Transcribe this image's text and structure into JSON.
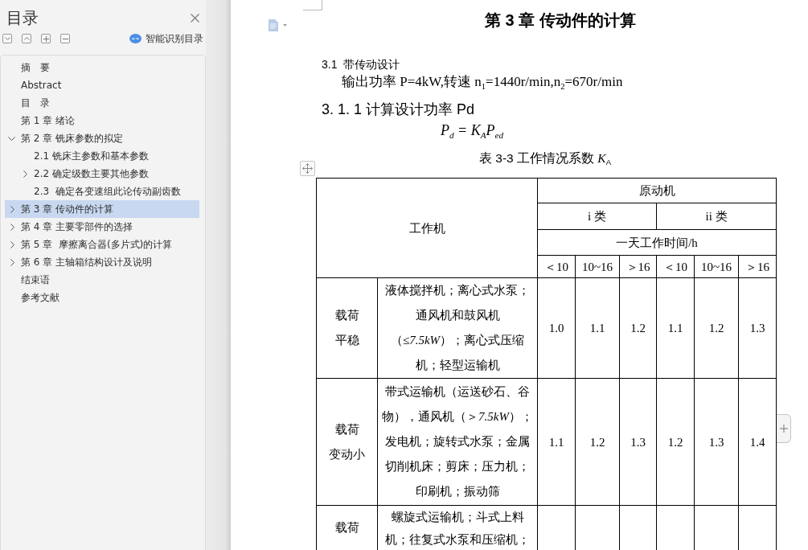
{
  "sidebar": {
    "title": "目录",
    "smart_toc": "智能识别目录",
    "items": [
      {
        "label": "摘　要",
        "selected": false
      },
      {
        "label": "Abstract",
        "selected": false
      },
      {
        "label": "目　录",
        "selected": false
      },
      {
        "label": "第 1 章 绪论",
        "selected": false
      },
      {
        "label": "第 2 章 铣床参数的拟定",
        "selected": false,
        "expanded": true,
        "children": [
          {
            "label": "2.1 铣床主参数和基本参数",
            "selected": false
          },
          {
            "label": "2.2 确定级数主要其他参数",
            "selected": false,
            "expanded": false
          },
          {
            "label": "2.3  确定各变速组此论传动副齿数",
            "selected": false
          }
        ]
      },
      {
        "label": "第 3 章 传动件的计算",
        "selected": true,
        "expanded": false
      },
      {
        "label": "第 4 章 主要零部件的选择",
        "selected": false,
        "expanded": false
      },
      {
        "label": "第 5 章  摩擦离合器(多片式)的计算",
        "selected": false,
        "expanded": false
      },
      {
        "label": "第 6 章 主轴箱结构设计及说明",
        "selected": false,
        "expanded": false
      },
      {
        "label": "结束语",
        "selected": false
      },
      {
        "label": "参考文献",
        "selected": false
      }
    ]
  },
  "document": {
    "chapter_title": "第 3 章 传动件的计算",
    "section_heading": "3.1  带传动设计",
    "given": "输出功率 P=4kW,转速 n$_{1}$=1440r/min,n$_{2}$=670r/min",
    "subsection_heading": "3. 1. 1 计算设计功率 Pd",
    "formula": "P$_{d}$ = K$_{A}$P$_{ed}$",
    "table_caption": "表 3-3 工作情况系数 *K*$_{A}$",
    "table": {
      "work_machine": "工作机",
      "prime_mover": "原动机",
      "classes": [
        "i 类",
        "ii 类"
      ],
      "hours_label": "一天工作时间/h",
      "hour_ranges": [
        "＜10",
        "10~16",
        "＞16",
        "＜10",
        "10~16",
        "＞16"
      ],
      "rows": [
        {
          "load": [
            "载荷",
            "平稳"
          ],
          "description": [
            "液体搅拌机；离心式水泵；",
            "通风机和鼓风机",
            "（≤*7.5kW*）；离心式压缩",
            "机；轻型运输机"
          ],
          "values": [
            "1.0",
            "1.1",
            "1.2",
            "1.1",
            "1.2",
            "1.3"
          ]
        },
        {
          "load": [
            "载荷",
            "变动小"
          ],
          "description": [
            "带式运输机（运送砂石、谷",
            "物），通风机（＞*7.5kW*）；",
            "发电机；旋转式水泵；金属",
            "切削机床；剪床；压力机；",
            "印刷机；振动筛"
          ],
          "values": [
            "1.1",
            "1.2",
            "1.3",
            "1.2",
            "1.3",
            "1.4"
          ]
        },
        {
          "load": [
            "载荷"
          ],
          "description": [
            "螺旋式运输机；斗式上料",
            "机；往复式水泵和压缩机；"
          ]
        }
      ]
    }
  }
}
